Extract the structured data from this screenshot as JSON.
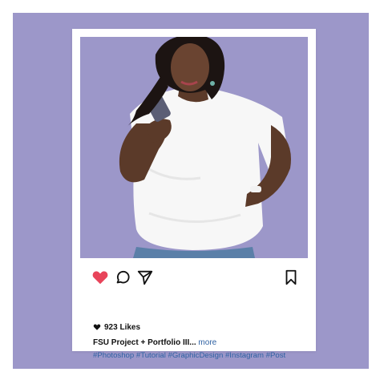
{
  "post": {
    "likes": "923 Likes",
    "caption_title": "FSU Project + Portfolio III...",
    "caption_more": "more",
    "hashtags": "#Photoshop #Tutorial #GraphicDesign #Instagram #Post"
  },
  "icons": {
    "like": "heart-icon",
    "comment": "comment-icon",
    "share": "send-icon",
    "save": "bookmark-icon",
    "likes_count": "heart-icon"
  },
  "colors": {
    "background_panel": "#9c97c9",
    "like_heart": "#e8445a",
    "link": "#2f62a3"
  }
}
